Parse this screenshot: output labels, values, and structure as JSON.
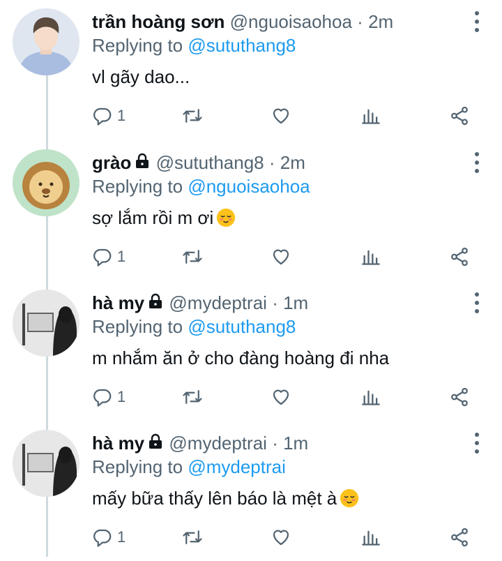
{
  "tweets": [
    {
      "name": "trần hoàng sơn",
      "locked": false,
      "handle": "@nguoisaohoa",
      "dot": "·",
      "time": "2m",
      "replying_prefix": "Replying to",
      "replying_to": "@sututhang8",
      "text": "vl gãy dao...",
      "emoji": false,
      "reply_count": "1",
      "avatar": "person-avatar-blue-hoodie"
    },
    {
      "name": "grào",
      "locked": true,
      "handle": "@sututhang8",
      "dot": "·",
      "time": "2m",
      "replying_prefix": "Replying to",
      "replying_to": "@nguoisaohoa",
      "text": "sợ lắm rồi m ơi",
      "emoji": true,
      "reply_count": "1",
      "avatar": "lion-cartoon-avatar"
    },
    {
      "name": "hà my",
      "locked": true,
      "handle": "@mydeptrai",
      "dot": "·",
      "time": "1m",
      "replying_prefix": "Replying to",
      "replying_to": "@sututhang8",
      "text": "m nhắm ăn ở cho đàng hoàng đi nha",
      "emoji": false,
      "reply_count": "1",
      "avatar": "person-avatar-easel"
    },
    {
      "name": "hà my",
      "locked": true,
      "handle": "@mydeptrai",
      "dot": "·",
      "time": "1m",
      "replying_prefix": "Replying to",
      "replying_to": "@mydeptrai",
      "text": "mấy bữa thấy lên báo là mệt à",
      "emoji": true,
      "reply_count": "1",
      "avatar": "person-avatar-easel"
    }
  ],
  "icons": {
    "reply": "reply-icon",
    "retweet": "retweet-icon",
    "like": "heart-icon",
    "analytics": "analytics-icon",
    "share": "share-icon",
    "more": "more-vertical-icon",
    "lock": "lock-icon",
    "emoji": "relieved-face-emoji"
  },
  "colors": {
    "link": "#1d9bf0",
    "secondary_text": "#536471",
    "primary_text": "#0f1419",
    "thread_line": "#cfd9de"
  }
}
